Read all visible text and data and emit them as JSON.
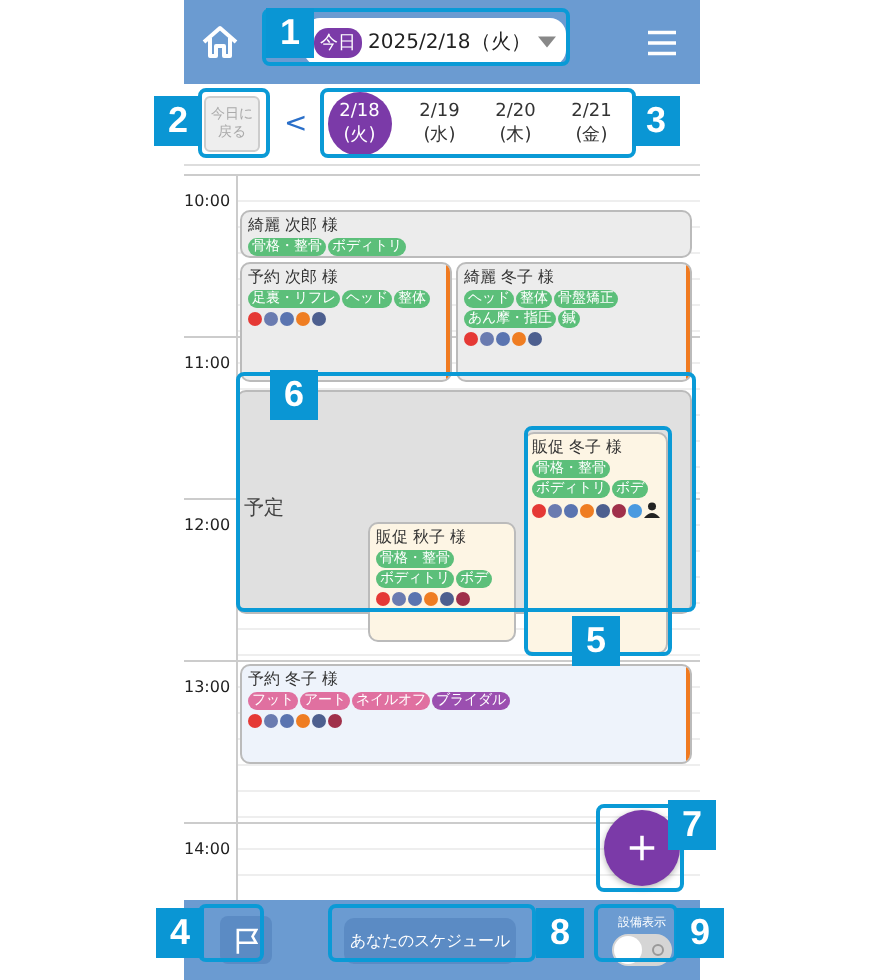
{
  "header": {
    "today_badge": "今日",
    "date": "2025/2/18（火）"
  },
  "date_nav": {
    "back_to_today": "今日に戻る",
    "back_disabled": true,
    "prev": "<",
    "days": [
      {
        "date": "2/18",
        "weekday": "(火)",
        "selected": true
      },
      {
        "date": "2/19",
        "weekday": "(水)",
        "selected": false
      },
      {
        "date": "2/20",
        "weekday": "(木)",
        "selected": false
      },
      {
        "date": "2/21",
        "weekday": "(金)",
        "selected": false
      }
    ]
  },
  "hours": [
    "10:00",
    "11:00",
    "12:00",
    "13:00",
    "14:00"
  ],
  "events": [
    {
      "kind": "booking",
      "title": "綺麗 次郎 様",
      "color": "#ececec",
      "tags": [
        {
          "label": "骨格・整骨",
          "color": "#5cbf7a"
        },
        {
          "label": "ボディトリ",
          "color": "#5cbf7a"
        }
      ]
    },
    {
      "kind": "booking",
      "title": "予約 次郎 様",
      "color": "#ececec",
      "bar": true,
      "tags": [
        {
          "label": "足裏・リフレ",
          "color": "#5cbf7a"
        },
        {
          "label": "ヘッド",
          "color": "#5cbf7a"
        },
        {
          "label": "整体",
          "color": "#5cbf7a"
        }
      ],
      "marks": [
        {
          "color": "#e53935"
        },
        {
          "color": "#6a7bb0"
        },
        {
          "color": "#5a74b0"
        },
        {
          "color": "#ef7d22"
        },
        {
          "color": "#4d5f8f"
        }
      ]
    },
    {
      "kind": "booking",
      "title": "綺麗 冬子 様",
      "color": "#ececec",
      "bar": true,
      "tags": [
        {
          "label": "ヘッド",
          "color": "#5cbf7a"
        },
        {
          "label": "整体",
          "color": "#5cbf7a"
        },
        {
          "label": "骨盤矯正",
          "color": "#5cbf7a"
        },
        {
          "label": "あん摩・指圧",
          "color": "#5cbf7a"
        },
        {
          "label": "鍼",
          "color": "#5cbf7a"
        }
      ],
      "marks": [
        {
          "color": "#e53935"
        },
        {
          "color": "#6a7bb0"
        },
        {
          "color": "#5a74b0"
        },
        {
          "color": "#ef7d22"
        },
        {
          "color": "#4d5f8f"
        }
      ]
    },
    {
      "kind": "block",
      "title": "予定",
      "color": "#e0e0e0"
    },
    {
      "kind": "booking",
      "title": "販促 秋子 様",
      "color": "#fdf5e4",
      "tags": [
        {
          "label": "骨格・整骨",
          "color": "#5cbf7a"
        },
        {
          "label": "ボディトリ",
          "color": "#5cbf7a"
        },
        {
          "label": "ボデ",
          "color": "#5cbf7a"
        }
      ],
      "marks": [
        {
          "color": "#e53935"
        },
        {
          "color": "#6a7bb0"
        },
        {
          "color": "#5a74b0"
        },
        {
          "color": "#ef7d22"
        },
        {
          "color": "#4d5f8f"
        },
        {
          "color": "#a0304a"
        }
      ]
    },
    {
      "kind": "booking",
      "title": "販促 冬子 様",
      "color": "#fdf5e4",
      "person": true,
      "tags": [
        {
          "label": "骨格・整骨",
          "color": "#5cbf7a"
        },
        {
          "label": "ボディトリ",
          "color": "#5cbf7a"
        },
        {
          "label": "ボデ",
          "color": "#5cbf7a"
        }
      ],
      "marks": [
        {
          "color": "#e53935"
        },
        {
          "color": "#6a7bb0"
        },
        {
          "color": "#5a74b0"
        },
        {
          "color": "#ef7d22"
        },
        {
          "color": "#4d5f8f"
        },
        {
          "color": "#a0304a"
        },
        {
          "color": "#4a9ae0"
        }
      ]
    },
    {
      "kind": "booking",
      "title": "予約 冬子 様",
      "color": "#eef3fb",
      "bar": true,
      "tags": [
        {
          "label": "フット",
          "color": "#e070a0"
        },
        {
          "label": "アート",
          "color": "#e070a0"
        },
        {
          "label": "ネイルオフ",
          "color": "#e070a0"
        },
        {
          "label": "ブライダル",
          "color": "#9b4fb0"
        }
      ],
      "marks": [
        {
          "color": "#e53935"
        },
        {
          "color": "#6a7bb0"
        },
        {
          "color": "#5a74b0"
        },
        {
          "color": "#ef7d22"
        },
        {
          "color": "#4d5f8f"
        },
        {
          "color": "#a0304a"
        }
      ]
    }
  ],
  "footer": {
    "schedule_button": "あなたのスケジュール",
    "equipment_label": "設備表示",
    "equipment_on": false
  },
  "callouts": [
    "1",
    "2",
    "3",
    "4",
    "5",
    "6",
    "7",
    "8",
    "9"
  ]
}
